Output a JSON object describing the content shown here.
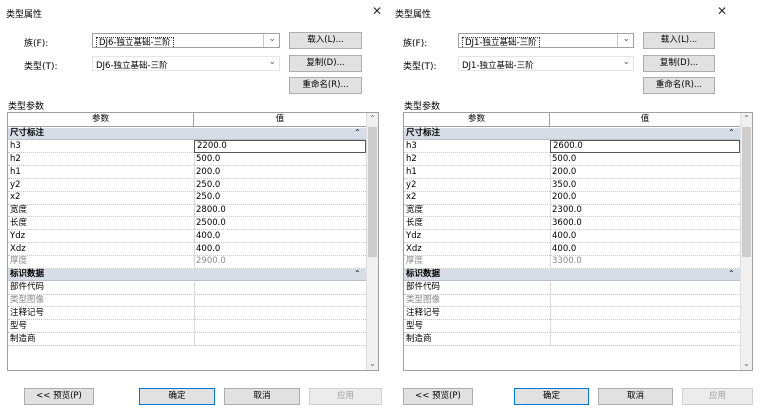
{
  "left": {
    "title": "类型属性",
    "family_label": "族(F):",
    "family_value": "DJ6-独立基础-三阶",
    "type_label": "类型(T):",
    "type_value": "DJ6-独立基础-三阶",
    "load_button": "载入(L)...",
    "duplicate_button": "复制(D)...",
    "rename_button": "重命名(R)...",
    "section_label": "类型参数",
    "col_param": "参数",
    "col_value": "值",
    "groups": [
      {
        "name": "尺寸标注",
        "rows": [
          {
            "param": "h3",
            "value": "2200.0"
          },
          {
            "param": "h2",
            "value": "500.0"
          },
          {
            "param": "h1",
            "value": "200.0"
          },
          {
            "param": "y2",
            "value": "250.0"
          },
          {
            "param": "x2",
            "value": "250.0"
          },
          {
            "param": "宽度",
            "value": "2800.0"
          },
          {
            "param": "长度",
            "value": "2500.0"
          },
          {
            "param": "Ydz",
            "value": "400.0"
          },
          {
            "param": "Xdz",
            "value": "400.0"
          },
          {
            "param": "厚度",
            "value": "2900.0"
          }
        ]
      },
      {
        "name": "标识数据",
        "rows": [
          {
            "param": "部件代码",
            "value": ""
          },
          {
            "param": "类型图像",
            "value": ""
          },
          {
            "param": "注释记号",
            "value": ""
          },
          {
            "param": "型号",
            "value": ""
          },
          {
            "param": "制造商",
            "value": ""
          }
        ]
      }
    ],
    "preview_button": "<< 预览(P)",
    "ok_button": "确定",
    "cancel_button": "取消",
    "apply_button": "应用"
  },
  "right": {
    "title": "类型属性",
    "family_label": "族(F):",
    "family_value": "DJ1-独立基础-三阶",
    "type_label": "类型(T):",
    "type_value": "DJ1-独立基础-三阶",
    "load_button": "载入(L)...",
    "duplicate_button": "复制(D)...",
    "rename_button": "重命名(R)...",
    "section_label": "类型参数",
    "col_param": "参数",
    "col_value": "值",
    "groups": [
      {
        "name": "尺寸标注",
        "rows": [
          {
            "param": "h3",
            "value": "2600.0"
          },
          {
            "param": "h2",
            "value": "500.0"
          },
          {
            "param": "h1",
            "value": "200.0"
          },
          {
            "param": "y2",
            "value": "350.0"
          },
          {
            "param": "x2",
            "value": "200.0"
          },
          {
            "param": "宽度",
            "value": "2300.0"
          },
          {
            "param": "长度",
            "value": "3600.0"
          },
          {
            "param": "Ydz",
            "value": "400.0"
          },
          {
            "param": "Xdz",
            "value": "400.0"
          },
          {
            "param": "厚度",
            "value": "3300.0"
          }
        ]
      },
      {
        "name": "标识数据",
        "rows": [
          {
            "param": "部件代码",
            "value": ""
          },
          {
            "param": "类型图像",
            "value": ""
          },
          {
            "param": "注释记号",
            "value": ""
          },
          {
            "param": "型号",
            "value": ""
          },
          {
            "param": "制造商",
            "value": ""
          }
        ]
      }
    ],
    "preview_button": "<< 预览(P)",
    "ok_button": "确定",
    "cancel_button": "取消",
    "apply_button": "应用"
  },
  "icons": {
    "close": "close-icon",
    "dropdown": "chevron-down-icon",
    "collapse": "double-chevron-up-icon",
    "scroll_up": "scroll-up-icon",
    "scroll_down": "scroll-down-icon"
  }
}
